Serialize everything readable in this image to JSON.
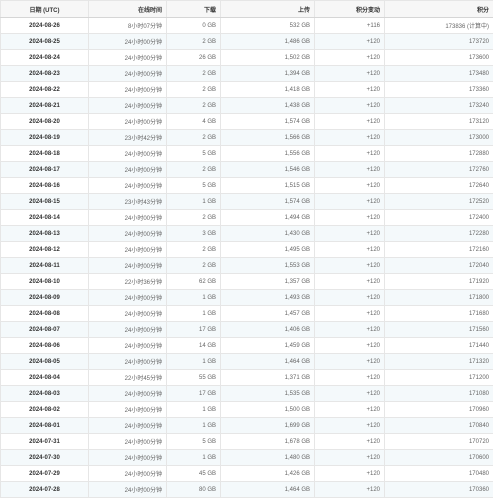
{
  "table": {
    "headers": {
      "date": "日期 (UTC)",
      "online": "在线时间",
      "download": "下载",
      "upload": "上传",
      "change": "积分变动",
      "points": "积分"
    },
    "rows": [
      {
        "date": "2024-08-26",
        "online": "8小时07分钟",
        "download": "0 GB",
        "upload": "532 GB",
        "change": "+116",
        "points": "173836 (计算中)"
      },
      {
        "date": "2024-08-25",
        "online": "24小时00分钟",
        "download": "2 GB",
        "upload": "1,486 GB",
        "change": "+120",
        "points": "173720"
      },
      {
        "date": "2024-08-24",
        "online": "24小时00分钟",
        "download": "26 GB",
        "upload": "1,502 GB",
        "change": "+120",
        "points": "173600"
      },
      {
        "date": "2024-08-23",
        "online": "24小时00分钟",
        "download": "2 GB",
        "upload": "1,394 GB",
        "change": "+120",
        "points": "173480"
      },
      {
        "date": "2024-08-22",
        "online": "24小时00分钟",
        "download": "2 GB",
        "upload": "1,418 GB",
        "change": "+120",
        "points": "173360"
      },
      {
        "date": "2024-08-21",
        "online": "24小时00分钟",
        "download": "2 GB",
        "upload": "1,438 GB",
        "change": "+120",
        "points": "173240"
      },
      {
        "date": "2024-08-20",
        "online": "24小时00分钟",
        "download": "4 GB",
        "upload": "1,574 GB",
        "change": "+120",
        "points": "173120"
      },
      {
        "date": "2024-08-19",
        "online": "23小时42分钟",
        "download": "2 GB",
        "upload": "1,566 GB",
        "change": "+120",
        "points": "173000"
      },
      {
        "date": "2024-08-18",
        "online": "24小时00分钟",
        "download": "5 GB",
        "upload": "1,556 GB",
        "change": "+120",
        "points": "172880"
      },
      {
        "date": "2024-08-17",
        "online": "24小时00分钟",
        "download": "2 GB",
        "upload": "1,546 GB",
        "change": "+120",
        "points": "172760"
      },
      {
        "date": "2024-08-16",
        "online": "24小时00分钟",
        "download": "5 GB",
        "upload": "1,515 GB",
        "change": "+120",
        "points": "172640"
      },
      {
        "date": "2024-08-15",
        "online": "23小时43分钟",
        "download": "1 GB",
        "upload": "1,574 GB",
        "change": "+120",
        "points": "172520"
      },
      {
        "date": "2024-08-14",
        "online": "24小时00分钟",
        "download": "2 GB",
        "upload": "1,494 GB",
        "change": "+120",
        "points": "172400"
      },
      {
        "date": "2024-08-13",
        "online": "24小时00分钟",
        "download": "3 GB",
        "upload": "1,430 GB",
        "change": "+120",
        "points": "172280"
      },
      {
        "date": "2024-08-12",
        "online": "24小时00分钟",
        "download": "2 GB",
        "upload": "1,495 GB",
        "change": "+120",
        "points": "172160"
      },
      {
        "date": "2024-08-11",
        "online": "24小时00分钟",
        "download": "2 GB",
        "upload": "1,553 GB",
        "change": "+120",
        "points": "172040"
      },
      {
        "date": "2024-08-10",
        "online": "22小时36分钟",
        "download": "62 GB",
        "upload": "1,357 GB",
        "change": "+120",
        "points": "171920"
      },
      {
        "date": "2024-08-09",
        "online": "24小时00分钟",
        "download": "1 GB",
        "upload": "1,493 GB",
        "change": "+120",
        "points": "171800"
      },
      {
        "date": "2024-08-08",
        "online": "24小时00分钟",
        "download": "1 GB",
        "upload": "1,457 GB",
        "change": "+120",
        "points": "171680"
      },
      {
        "date": "2024-08-07",
        "online": "24小时00分钟",
        "download": "17 GB",
        "upload": "1,406 GB",
        "change": "+120",
        "points": "171560"
      },
      {
        "date": "2024-08-06",
        "online": "24小时00分钟",
        "download": "14 GB",
        "upload": "1,459 GB",
        "change": "+120",
        "points": "171440"
      },
      {
        "date": "2024-08-05",
        "online": "24小时00分钟",
        "download": "1 GB",
        "upload": "1,464 GB",
        "change": "+120",
        "points": "171320"
      },
      {
        "date": "2024-08-04",
        "online": "22小时45分钟",
        "download": "55 GB",
        "upload": "1,371 GB",
        "change": "+120",
        "points": "171200"
      },
      {
        "date": "2024-08-03",
        "online": "24小时00分钟",
        "download": "17 GB",
        "upload": "1,535 GB",
        "change": "+120",
        "points": "171080"
      },
      {
        "date": "2024-08-02",
        "online": "24小时00分钟",
        "download": "1 GB",
        "upload": "1,500 GB",
        "change": "+120",
        "points": "170960"
      },
      {
        "date": "2024-08-01",
        "online": "24小时00分钟",
        "download": "1 GB",
        "upload": "1,699 GB",
        "change": "+120",
        "points": "170840"
      },
      {
        "date": "2024-07-31",
        "online": "24小时00分钟",
        "download": "5 GB",
        "upload": "1,678 GB",
        "change": "+120",
        "points": "170720"
      },
      {
        "date": "2024-07-30",
        "online": "24小时00分钟",
        "download": "1 GB",
        "upload": "1,480 GB",
        "change": "+120",
        "points": "170600"
      },
      {
        "date": "2024-07-29",
        "online": "24小时00分钟",
        "download": "45 GB",
        "upload": "1,426 GB",
        "change": "+120",
        "points": "170480"
      },
      {
        "date": "2024-07-28",
        "online": "24小时00分钟",
        "download": "80 GB",
        "upload": "1,464 GB",
        "change": "+120",
        "points": "170360"
      }
    ]
  }
}
